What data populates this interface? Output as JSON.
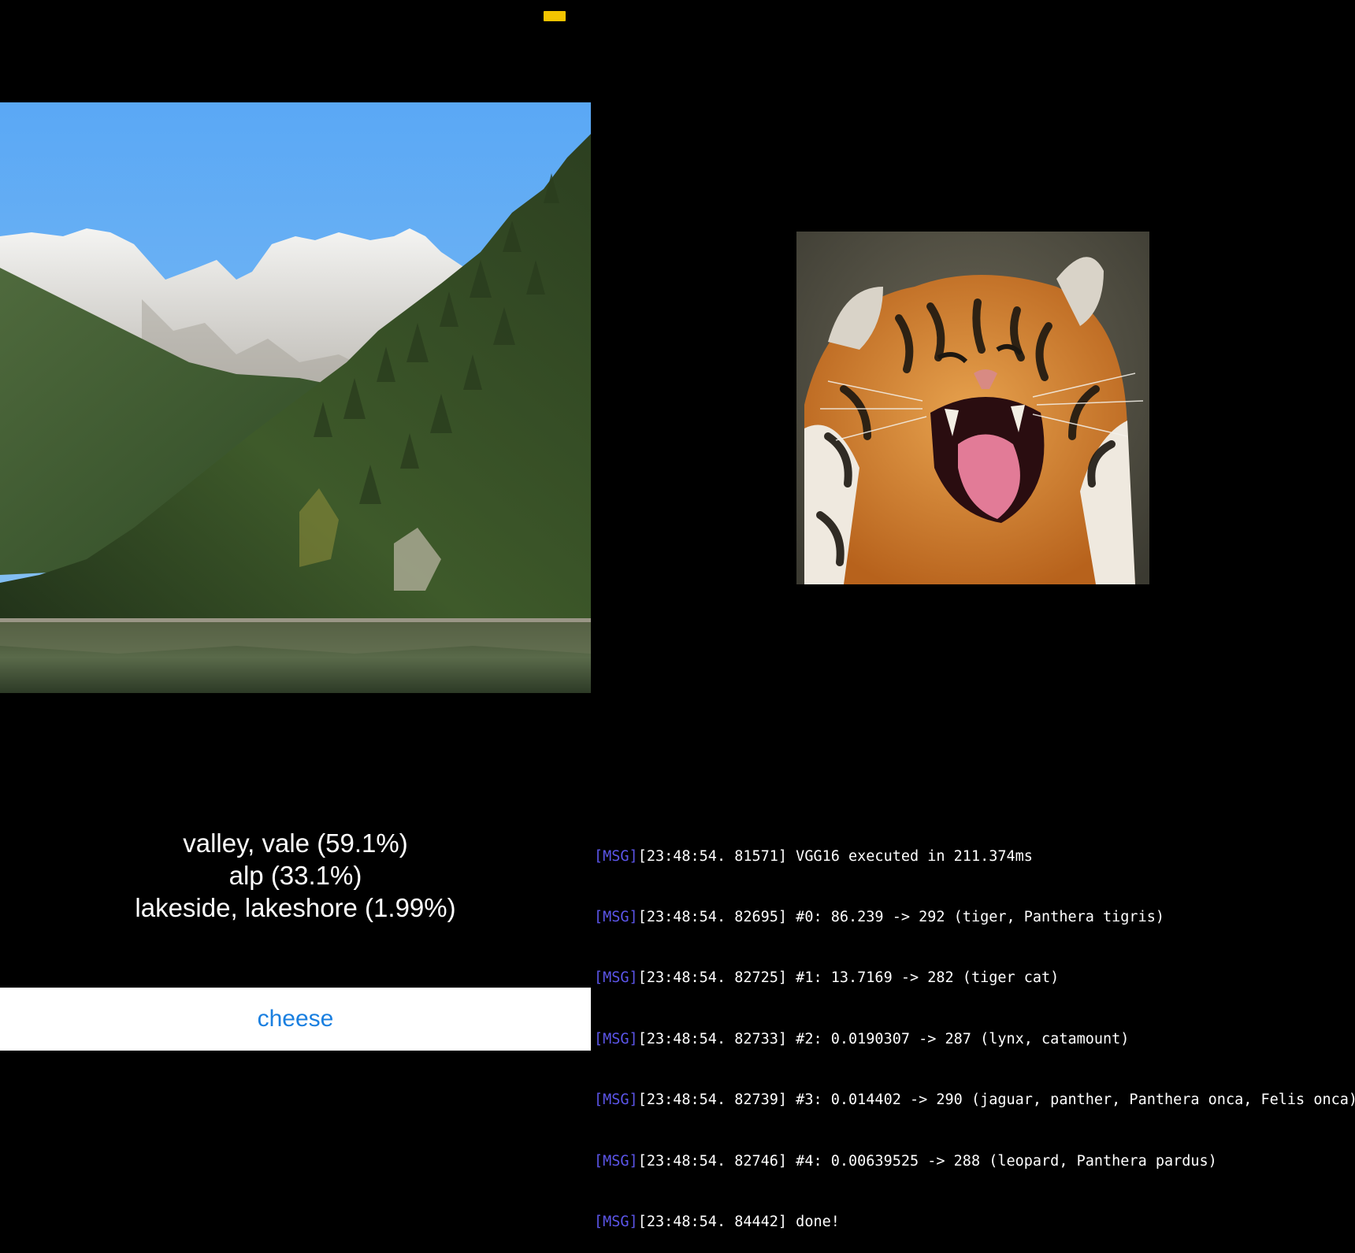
{
  "predictions": [
    {
      "label": "valley, vale (59.1%)"
    },
    {
      "label": "alp (33.1%)"
    },
    {
      "label": "lakeside, lakeshore (1.99%)"
    }
  ],
  "cheese_button": "cheese",
  "log": {
    "lines": [
      {
        "tag": "[MSG]",
        "text": "[23:48:54. 81571] VGG16 executed in 211.374ms"
      },
      {
        "tag": "[MSG]",
        "text": "[23:48:54. 82695] #0: 86.239 -> 292 (tiger, Panthera tigris)"
      },
      {
        "tag": "[MSG]",
        "text": "[23:48:54. 82725] #1: 13.7169 -> 282 (tiger cat)"
      },
      {
        "tag": "[MSG]",
        "text": "[23:48:54. 82733] #2: 0.0190307 -> 287 (lynx, catamount)"
      },
      {
        "tag": "[MSG]",
        "text": "[23:48:54. 82739] #3: 0.014402 -> 290 (jaguar, panther, Panthera onca, Felis onca)"
      },
      {
        "tag": "[MSG]",
        "text": "[23:48:54. 82746] #4: 0.00639525 -> 288 (leopard, Panthera pardus)"
      },
      {
        "tag": "[MSG]",
        "text": "[23:48:54. 84442] done!"
      }
    ]
  },
  "colors": {
    "background": "#000000",
    "status_indicator": "#f3c400",
    "button_text": "#1a7fe0",
    "log_tag": "#5b55e8"
  }
}
